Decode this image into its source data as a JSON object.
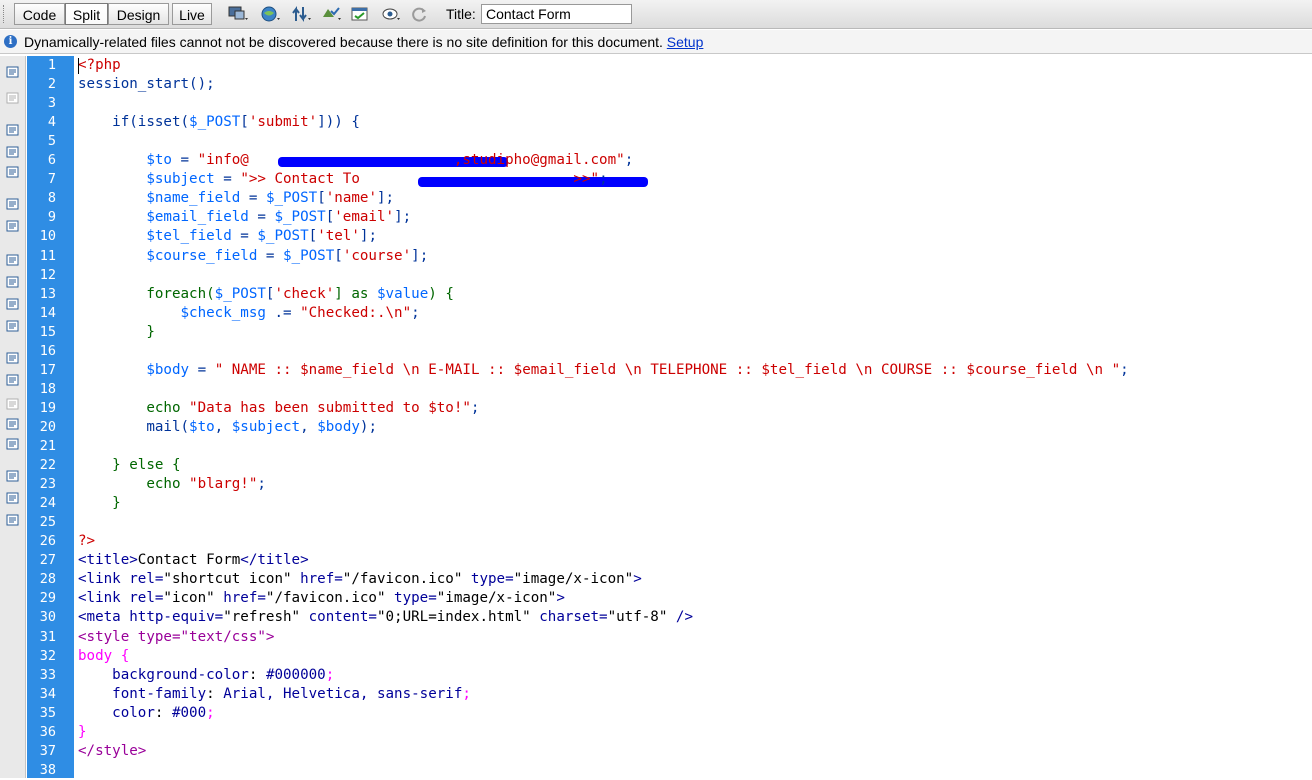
{
  "toolbar": {
    "views": [
      "Code",
      "Split",
      "Design",
      "Live"
    ],
    "active_view": "Split",
    "title_label": "Title:",
    "title_value": "Contact Form",
    "icons": [
      "multiscreen-icon",
      "preview-browser-icon",
      "file-management-icon",
      "w3c-validation-icon",
      "check-browser-compat-icon",
      "visual-aids-icon",
      "refresh-icon"
    ]
  },
  "infobar": {
    "message": "Dynamically-related files cannot not be discovered because there is no site definition for this document.",
    "link": "Setup"
  },
  "sidebar_icons": [
    "open-documents-icon",
    "show-code-navigator-icon",
    "collapse-full-tag-icon",
    "collapse-selection-icon",
    "expand-all-icon",
    "select-parent-tag-icon",
    "balance-braces-icon",
    "line-numbers-icon",
    "highlight-invalid-code-icon",
    "word-wrap-icon",
    "syntax-coloring-icon",
    "apply-comment-icon",
    "remove-comment-icon",
    "wrap-tag-icon",
    "recent-snippets-icon",
    "move-css-icon",
    "indent-code-icon",
    "outdent-code-icon",
    "format-source-icon"
  ],
  "colors": {
    "gutter": "#2f8de4",
    "php_delim": "#cc0000",
    "php_code": "#003399",
    "php_var": "#0066ff",
    "php_string": "#cc0000",
    "php_keyword": "#006600",
    "html_tag": "#000099",
    "attr_value": "#000000",
    "css_selector": "#ff00ff",
    "css_prop": "#000099",
    "redaction": "#0000ff"
  },
  "code_lines": [
    {
      "n": "1",
      "tokens": [
        [
          "<?php",
          "#cc0000"
        ]
      ]
    },
    {
      "n": "2",
      "tokens": [
        [
          "session_start();",
          "#003399"
        ]
      ]
    },
    {
      "n": "3",
      "tokens": []
    },
    {
      "n": "4",
      "tokens": [
        [
          "    if(isset(",
          "#003399"
        ],
        [
          "$_POST",
          "#0066ff"
        ],
        [
          "[",
          "#003399"
        ],
        [
          "'submit'",
          "#cc0000"
        ],
        [
          "])) {",
          "#003399"
        ]
      ]
    },
    {
      "n": "5",
      "tokens": []
    },
    {
      "n": "6",
      "tokens": [
        [
          "        ",
          "#000"
        ],
        [
          "$to",
          "#0066ff"
        ],
        [
          " = ",
          "#003399"
        ],
        [
          "\"info@                        ,studipho@gmail.com\"",
          "#cc0000"
        ],
        [
          ";",
          "#003399"
        ]
      ]
    },
    {
      "n": "7",
      "tokens": [
        [
          "        ",
          "#000"
        ],
        [
          "$subject",
          "#0066ff"
        ],
        [
          " = ",
          "#003399"
        ],
        [
          "\">> Contact To                         >>\"",
          "#cc0000"
        ],
        [
          ";",
          "#003399"
        ]
      ]
    },
    {
      "n": "8",
      "tokens": [
        [
          "        ",
          "#000"
        ],
        [
          "$name_field",
          "#0066ff"
        ],
        [
          " = ",
          "#003399"
        ],
        [
          "$_POST",
          "#0066ff"
        ],
        [
          "[",
          "#003399"
        ],
        [
          "'name'",
          "#cc0000"
        ],
        [
          "];",
          "#003399"
        ]
      ]
    },
    {
      "n": "9",
      "tokens": [
        [
          "        ",
          "#000"
        ],
        [
          "$email_field",
          "#0066ff"
        ],
        [
          " = ",
          "#003399"
        ],
        [
          "$_POST",
          "#0066ff"
        ],
        [
          "[",
          "#003399"
        ],
        [
          "'email'",
          "#cc0000"
        ],
        [
          "];",
          "#003399"
        ]
      ]
    },
    {
      "n": "10",
      "tokens": [
        [
          "        ",
          "#000"
        ],
        [
          "$tel_field",
          "#0066ff"
        ],
        [
          " = ",
          "#003399"
        ],
        [
          "$_POST",
          "#0066ff"
        ],
        [
          "[",
          "#003399"
        ],
        [
          "'tel'",
          "#cc0000"
        ],
        [
          "];",
          "#003399"
        ]
      ]
    },
    {
      "n": "11",
      "tokens": [
        [
          "        ",
          "#000"
        ],
        [
          "$course_field",
          "#0066ff"
        ],
        [
          " = ",
          "#003399"
        ],
        [
          "$_POST",
          "#0066ff"
        ],
        [
          "[",
          "#003399"
        ],
        [
          "'course'",
          "#cc0000"
        ],
        [
          "];",
          "#003399"
        ]
      ]
    },
    {
      "n": "12",
      "tokens": []
    },
    {
      "n": "13",
      "tokens": [
        [
          "        foreach(",
          "#006600"
        ],
        [
          "$_POST",
          "#0066ff"
        ],
        [
          "[",
          "#003399"
        ],
        [
          "'check'",
          "#cc0000"
        ],
        [
          "] as ",
          "#006600"
        ],
        [
          "$value",
          "#0066ff"
        ],
        [
          ") {",
          "#006600"
        ]
      ]
    },
    {
      "n": "14",
      "tokens": [
        [
          "            ",
          "#000"
        ],
        [
          "$check_msg",
          "#0066ff"
        ],
        [
          " .= ",
          "#003399"
        ],
        [
          "\"Checked:.\\n\"",
          "#cc0000"
        ],
        [
          ";",
          "#003399"
        ]
      ]
    },
    {
      "n": "15",
      "tokens": [
        [
          "        }",
          "#006600"
        ]
      ]
    },
    {
      "n": "16",
      "tokens": []
    },
    {
      "n": "17",
      "tokens": [
        [
          "        ",
          "#000"
        ],
        [
          "$body",
          "#0066ff"
        ],
        [
          " = ",
          "#003399"
        ],
        [
          "\" NAME :: ",
          "#cc0000"
        ],
        [
          "$name_field",
          "#cc0000"
        ],
        [
          " \\n E-MAIL :: ",
          "#cc0000"
        ],
        [
          "$email_field",
          "#cc0000"
        ],
        [
          " \\n TELEPHONE :: ",
          "#cc0000"
        ],
        [
          "$tel_field",
          "#cc0000"
        ],
        [
          " \\n COURSE :: ",
          "#cc0000"
        ],
        [
          "$course_field",
          "#cc0000"
        ],
        [
          " \\n \"",
          "#cc0000"
        ],
        [
          ";",
          "#003399"
        ]
      ]
    },
    {
      "n": "18",
      "tokens": []
    },
    {
      "n": "19",
      "tokens": [
        [
          "        echo ",
          "#006600"
        ],
        [
          "\"Data has been submitted to $to!\"",
          "#cc0000"
        ],
        [
          ";",
          "#003399"
        ]
      ]
    },
    {
      "n": "20",
      "tokens": [
        [
          "        mail(",
          "#003399"
        ],
        [
          "$to",
          "#0066ff"
        ],
        [
          ", ",
          "#003399"
        ],
        [
          "$subject",
          "#0066ff"
        ],
        [
          ", ",
          "#003399"
        ],
        [
          "$body",
          "#0066ff"
        ],
        [
          ");",
          "#003399"
        ]
      ]
    },
    {
      "n": "21",
      "tokens": []
    },
    {
      "n": "22",
      "tokens": [
        [
          "    } else {",
          "#006600"
        ]
      ]
    },
    {
      "n": "23",
      "tokens": [
        [
          "        echo ",
          "#006600"
        ],
        [
          "\"blarg!\"",
          "#cc0000"
        ],
        [
          ";",
          "#003399"
        ]
      ]
    },
    {
      "n": "24",
      "tokens": [
        [
          "    }",
          "#006600"
        ]
      ]
    },
    {
      "n": "25",
      "tokens": []
    },
    {
      "n": "26",
      "tokens": [
        [
          "?>",
          "#cc0000"
        ]
      ]
    },
    {
      "n": "27",
      "tokens": [
        [
          "<title>",
          "#000099"
        ],
        [
          "Contact Form",
          "#000000"
        ],
        [
          "</title>",
          "#000099"
        ]
      ]
    },
    {
      "n": "28",
      "tokens": [
        [
          "<link rel=",
          "#000099"
        ],
        [
          "\"shortcut icon\"",
          "#000000"
        ],
        [
          " href=",
          "#000099"
        ],
        [
          "\"/favicon.ico\"",
          "#000000"
        ],
        [
          " type=",
          "#000099"
        ],
        [
          "\"image/x-icon\"",
          "#000000"
        ],
        [
          ">",
          "#000099"
        ]
      ]
    },
    {
      "n": "29",
      "tokens": [
        [
          "<link rel=",
          "#000099"
        ],
        [
          "\"icon\"",
          "#000000"
        ],
        [
          " href=",
          "#000099"
        ],
        [
          "\"/favicon.ico\"",
          "#000000"
        ],
        [
          " type=",
          "#000099"
        ],
        [
          "\"image/x-icon\"",
          "#000000"
        ],
        [
          ">",
          "#000099"
        ]
      ]
    },
    {
      "n": "30",
      "tokens": [
        [
          "<meta http-equiv=",
          "#000099"
        ],
        [
          "\"refresh\"",
          "#000000"
        ],
        [
          " content=",
          "#000099"
        ],
        [
          "\"0;URL=index.html\"",
          "#000000"
        ],
        [
          " charset=",
          "#000099"
        ],
        [
          "\"utf-8\"",
          "#000000"
        ],
        [
          " />",
          "#000099"
        ]
      ]
    },
    {
      "n": "31",
      "tokens": [
        [
          "<style type=",
          "#990099"
        ],
        [
          "\"text/css\"",
          "#990099"
        ],
        [
          ">",
          "#990099"
        ]
      ]
    },
    {
      "n": "32",
      "tokens": [
        [
          "body {",
          "#ff00ff"
        ]
      ]
    },
    {
      "n": "33",
      "tokens": [
        [
          "    background-color",
          "#000099"
        ],
        [
          ": ",
          "#000"
        ],
        [
          "#000000",
          "#000099"
        ],
        [
          ";",
          "#ff00ff"
        ]
      ]
    },
    {
      "n": "34",
      "tokens": [
        [
          "    font-family",
          "#000099"
        ],
        [
          ": ",
          "#000"
        ],
        [
          "Arial, Helvetica, sans-serif",
          "#000099"
        ],
        [
          ";",
          "#ff00ff"
        ]
      ]
    },
    {
      "n": "35",
      "tokens": [
        [
          "    color",
          "#000099"
        ],
        [
          ": ",
          "#000"
        ],
        [
          "#000",
          "#000099"
        ],
        [
          ";",
          "#ff00ff"
        ]
      ]
    },
    {
      "n": "36",
      "tokens": [
        [
          "}",
          "#ff00ff"
        ]
      ]
    },
    {
      "n": "37",
      "tokens": [
        [
          "</style>",
          "#990099"
        ]
      ]
    },
    {
      "n": "38",
      "tokens": []
    }
  ]
}
